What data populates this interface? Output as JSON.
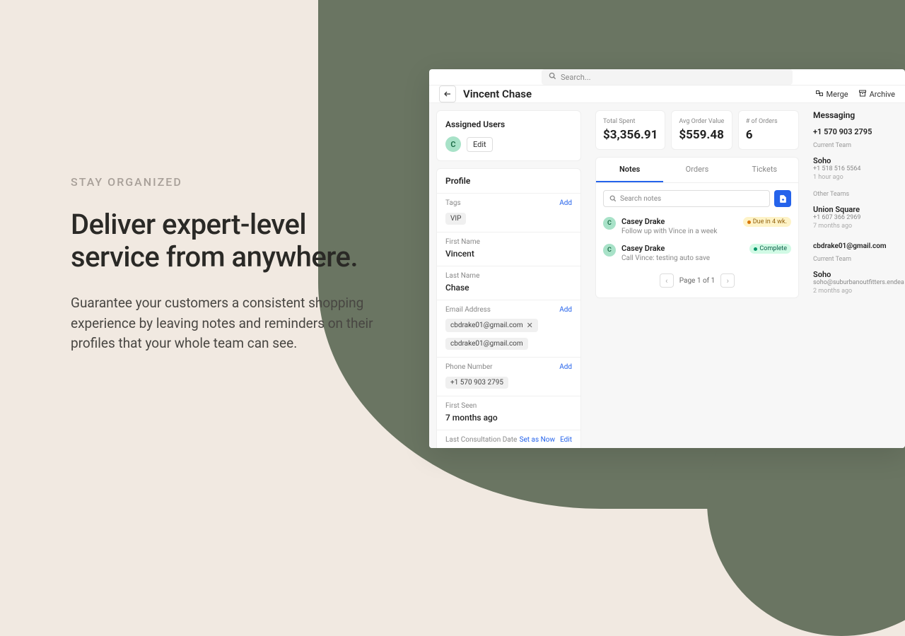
{
  "hero": {
    "eyebrow": "STAY ORGANIZED",
    "headline": "Deliver expert-level service from anywhere.",
    "subcopy": "Guarantee your customers a consistent shopping experience by leaving notes and reminders on their profiles that your whole team can see."
  },
  "search": {
    "placeholder": "Search..."
  },
  "header": {
    "title": "Vincent Chase",
    "merge": "Merge",
    "archive": "Archive"
  },
  "assigned": {
    "title": "Assigned Users",
    "avatar": "C",
    "edit": "Edit"
  },
  "profile": {
    "title": "Profile",
    "tags": {
      "label": "Tags",
      "add": "Add",
      "values": [
        "VIP"
      ]
    },
    "firstName": {
      "label": "First Name",
      "value": "Vincent"
    },
    "lastName": {
      "label": "Last Name",
      "value": "Chase"
    },
    "email": {
      "label": "Email Address",
      "add": "Add",
      "values": [
        "cbdrake01@gmail.com",
        "cbdrake01@gmail.com"
      ]
    },
    "phone": {
      "label": "Phone Number",
      "add": "Add",
      "values": [
        "+1 570 903 2795"
      ]
    },
    "firstSeen": {
      "label": "First Seen",
      "value": "7 months ago"
    },
    "lastConsult": {
      "label": "Last Consultation Date",
      "setNow": "Set as Now",
      "edit": "Edit"
    }
  },
  "stats": {
    "totalSpent": {
      "label": "Total Spent",
      "value": "$3,356.91"
    },
    "avgOrder": {
      "label": "Avg Order Value",
      "value": "$559.48"
    },
    "numOrders": {
      "label": "# of Orders",
      "value": "6"
    }
  },
  "tabs": {
    "notes": "Notes",
    "orders": "Orders",
    "tickets": "Tickets"
  },
  "notes": {
    "searchPlaceholder": "Search notes",
    "items": [
      {
        "avatar": "C",
        "author": "Casey Drake",
        "text": "Follow up with Vince in a week",
        "badge": "Due in 4 wk.",
        "badgeType": "due"
      },
      {
        "avatar": "C",
        "author": "Casey Drake",
        "text": "Call Vince: testing auto save",
        "badge": "Complete",
        "badgeType": "complete"
      }
    ],
    "pager": "Page 1 of 1"
  },
  "messaging": {
    "title": "Messaging",
    "phone": "+1 570 903 2795",
    "currentTeamLabel": "Current Team",
    "otherTeamsLabel": "Other Teams",
    "currentTeam": {
      "name": "Soho",
      "sub": "+1 518 516 5564",
      "time": "1 hour ago"
    },
    "otherTeam": {
      "name": "Union Square",
      "sub": "+1 607 366 2969",
      "time": "7 months ago"
    },
    "email": "cbdrake01@gmail.com",
    "emailTeam": {
      "name": "Soho",
      "sub": "soho@suburbanoutfitters.endea",
      "time": "2 months ago"
    }
  }
}
